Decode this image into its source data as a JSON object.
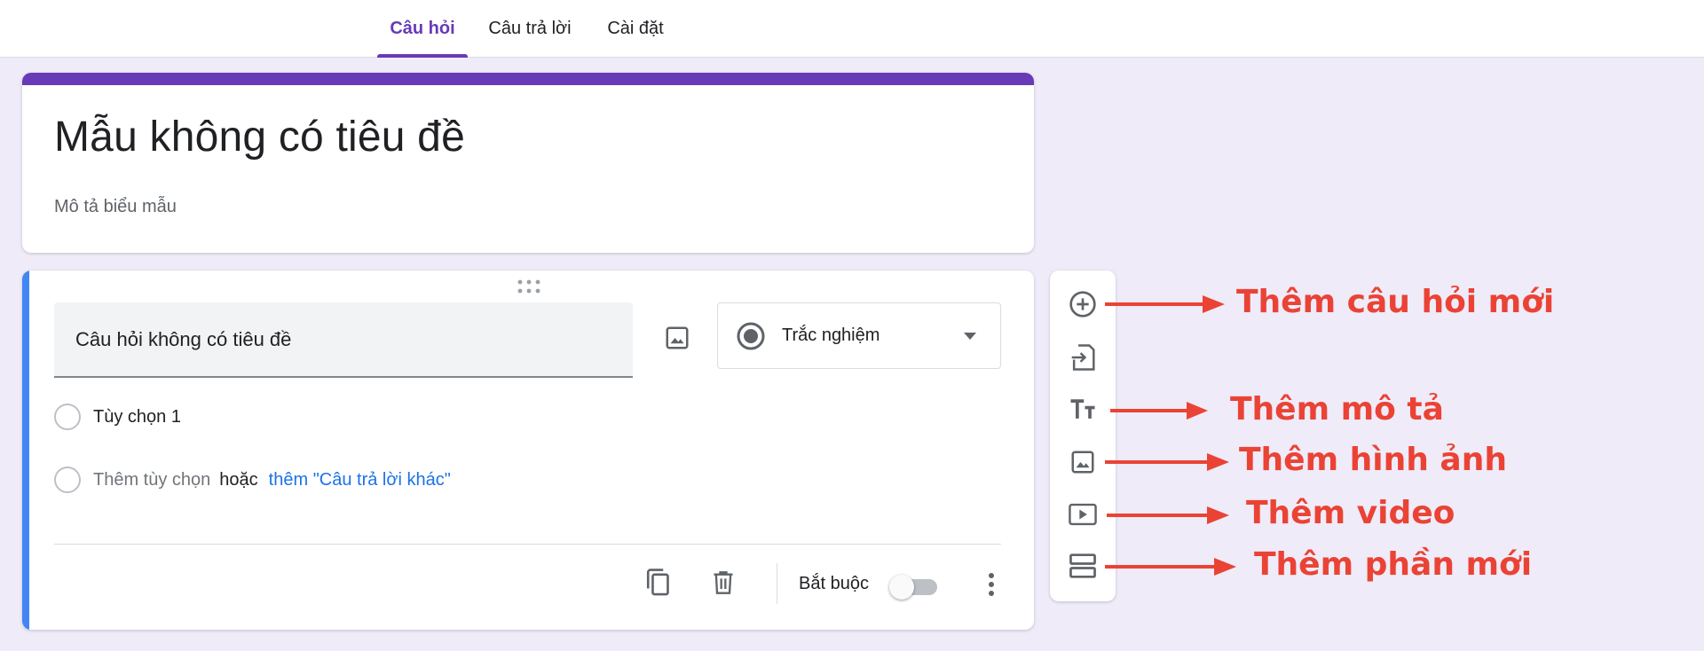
{
  "tabs": [
    {
      "label": "Câu hỏi",
      "active": true
    },
    {
      "label": "Câu trả lời",
      "active": false
    },
    {
      "label": "Cài đặt",
      "active": false
    }
  ],
  "form": {
    "title": "Mẫu không có tiêu đề",
    "description": "Mô tả biểu mẫu"
  },
  "question": {
    "title": "Câu hỏi không có tiêu đề",
    "type": "Trắc nghiệm",
    "option_1": "Tùy chọn 1",
    "add_option": "Thêm tùy chọn",
    "or": "hoặc",
    "add_other": "thêm \"Câu trả lời khác\"",
    "required_label": "Bắt buộc",
    "required": false
  },
  "toolbar": {
    "items": [
      {
        "name": "add-question",
        "icon": "add-circle-icon"
      },
      {
        "name": "import-questions",
        "icon": "import-icon"
      },
      {
        "name": "add-title-description",
        "icon": "text-size-icon"
      },
      {
        "name": "add-image",
        "icon": "image-icon"
      },
      {
        "name": "add-video",
        "icon": "video-icon"
      },
      {
        "name": "add-section",
        "icon": "section-icon"
      }
    ]
  },
  "annotations": [
    {
      "label": "Thêm câu hỏi mới"
    },
    {
      "label": "Thêm mô tả"
    },
    {
      "label": "Thêm hình ảnh"
    },
    {
      "label": "Thêm video"
    },
    {
      "label": "Thêm phần mới"
    }
  ],
  "colors": {
    "accent": "#673ab7",
    "question_bar": "#4285f4",
    "annotation": "#ea4335",
    "link": "#1a73e8",
    "background": "#efebf8"
  }
}
